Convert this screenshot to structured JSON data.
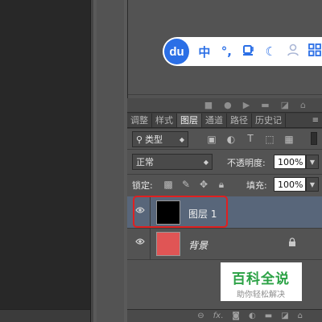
{
  "ime_toolbar": {
    "logo": "du",
    "items": [
      {
        "label": "中",
        "icon": "chinese-mode-icon"
      },
      {
        "label": "°,",
        "icon": "punctuation-icon"
      },
      {
        "label": "",
        "icon": "cup-icon"
      },
      {
        "label": "☾",
        "icon": "moon-icon"
      },
      {
        "label": "",
        "icon": "user-icon"
      },
      {
        "label": "",
        "icon": "grid-icon"
      }
    ],
    "colors": {
      "accent": "#2b6fe6"
    }
  },
  "panel": {
    "tabs": [
      {
        "label": "调整",
        "active": false
      },
      {
        "label": "样式",
        "active": false
      },
      {
        "label": "图层",
        "active": true
      },
      {
        "label": "通道",
        "active": false
      },
      {
        "label": "路径",
        "active": false
      },
      {
        "label": "历史记"
      }
    ],
    "menu_icon": "≡"
  },
  "layers_panel": {
    "filter": {
      "value": "类型"
    },
    "blend_mode": {
      "value": "正常"
    },
    "opacity": {
      "label": "不透明度:",
      "value": "100%"
    },
    "lock": {
      "label": "锁定:"
    },
    "fill": {
      "label": "填充:",
      "value": "100%"
    },
    "layers": [
      {
        "name": "图层 1",
        "thumb_color": "#000000",
        "selected": true,
        "locked": false
      },
      {
        "name": "背景",
        "thumb_color": "#e05555",
        "selected": false,
        "locked": true
      }
    ]
  },
  "watermark": {
    "title": "百科全说",
    "subtitle": "助你轻松解决"
  }
}
